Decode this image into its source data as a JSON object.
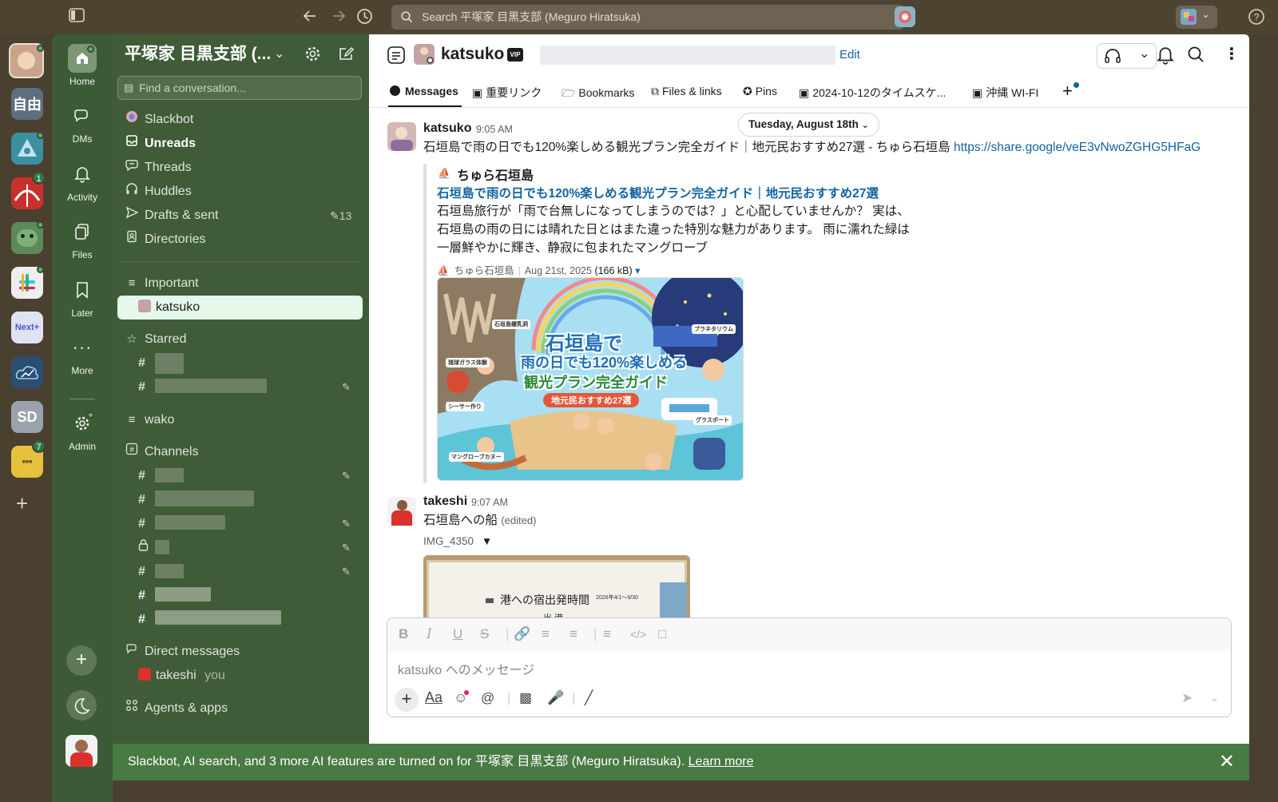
{
  "topbar": {
    "search_placeholder": "Search 平塚家 目黒支部 (Meguro Hiratsuka)"
  },
  "workspaces": [
    {
      "label": "自由",
      "badge": ""
    },
    {
      "label": "Next",
      "badge": ""
    },
    {
      "label": "SD",
      "badge": ""
    },
    {
      "badge_1": "1",
      "badge_7": "7"
    }
  ],
  "ws_badges": {
    "b1": "1",
    "b7": "7"
  },
  "ws_labels": {
    "jiyu": "自由",
    "next": "Next",
    "sd": "SD"
  },
  "rail": {
    "home": "Home",
    "dms": "DMs",
    "activity": "Activity",
    "files": "Files",
    "later": "Later",
    "more": "More",
    "admin": "Admin"
  },
  "sidebar": {
    "workspace_title": "平塚家 目黒支部 (...",
    "find_placeholder": "Find a conversation...",
    "items": {
      "slackbot": "Slackbot",
      "unreads": "Unreads",
      "threads": "Threads",
      "huddles": "Huddles",
      "drafts": "Drafts & sent",
      "drafts_count": "13",
      "directories": "Directories",
      "important": "Important",
      "katsuko": "katsuko",
      "starred": "Starred",
      "wako": "wako",
      "channels": "Channels",
      "direct_messages": "Direct messages",
      "dm_takeshi": "takeshi",
      "dm_you": "you",
      "agents": "Agents & apps"
    }
  },
  "channel_header": {
    "name": "katsuko",
    "vip": "VIP",
    "edit": "Edit"
  },
  "tabs": {
    "messages": "Messages",
    "links": "重要リンク",
    "bookmarks": "Bookmarks",
    "files_links": "Files & links",
    "pins": "Pins",
    "timeschedule": "2024-10-12のタイムスケ...",
    "wifi": "沖縄 WI-FI"
  },
  "date_divider": "Tuesday, August 18th",
  "messages": {
    "m1": {
      "author": "katsuko",
      "time": "9:05 AM",
      "text": "石垣島で雨の日でも120%楽しめる観光プラン完全ガイド｜地元民おすすめ27選 - ちゅら石垣島 ",
      "link": "https://share.google/veE3vNwoZGHG5HFaG",
      "unfurl": {
        "site": "ちゅら石垣島",
        "title": "石垣島で雨の日でも120%楽しめる観光プラン完全ガイド｜地元民おすすめ27選",
        "desc": "石垣島旅行が「雨で台無しになってしまうのでは？」と心配していませんか？ 実は、石垣島の雨の日には晴れた日とはまた違った特別な魅力があります。 雨に濡れた緑は一層鮮やかに輝き、静寂に包まれたマングローブ",
        "meta_site": "ちゅら石垣島",
        "meta_date": "Aug 21st, 2025",
        "meta_size": "(166 kB)"
      },
      "image_text": {
        "line1": "石垣島で",
        "line2": "雨の日でも120%楽しめる",
        "line3": "観光プラン完全ガイド",
        "line4": "地元民おすすめ27選",
        "tag1": "石垣島鍾乳洞",
        "tag2": "プラネタリウム",
        "tag3": "琉球ガラス体験",
        "tag4": "シーサー作り",
        "tag5": "グラスボート",
        "tag6": "マングローブカヌー"
      }
    },
    "m2": {
      "author": "takeshi",
      "time": "9:07 AM",
      "text": "石垣島への船",
      "edited": "(edited)",
      "file_name": "IMG_4350",
      "photo_text": "港への宿出発時間",
      "photo_date": "2026年4/1〜9/30",
      "photo_text2": "出 港"
    }
  },
  "composer": {
    "placeholder": "katsuko へのメッセージ"
  },
  "footer": {
    "text": "Slackbot, AI search, and 3 more AI features are turned on for 平塚家 目黒支部 (Meguro Hiratsuka). ",
    "learn_more": "Learn more"
  },
  "colors": {
    "rail_bg": "#3d5a36",
    "sidebar_bg": "#3f5b38",
    "topbar_bg": "#4d4331",
    "selected_bg": "#e6f8ea",
    "link": "#1264a3",
    "footer_bg": "#487a43"
  }
}
